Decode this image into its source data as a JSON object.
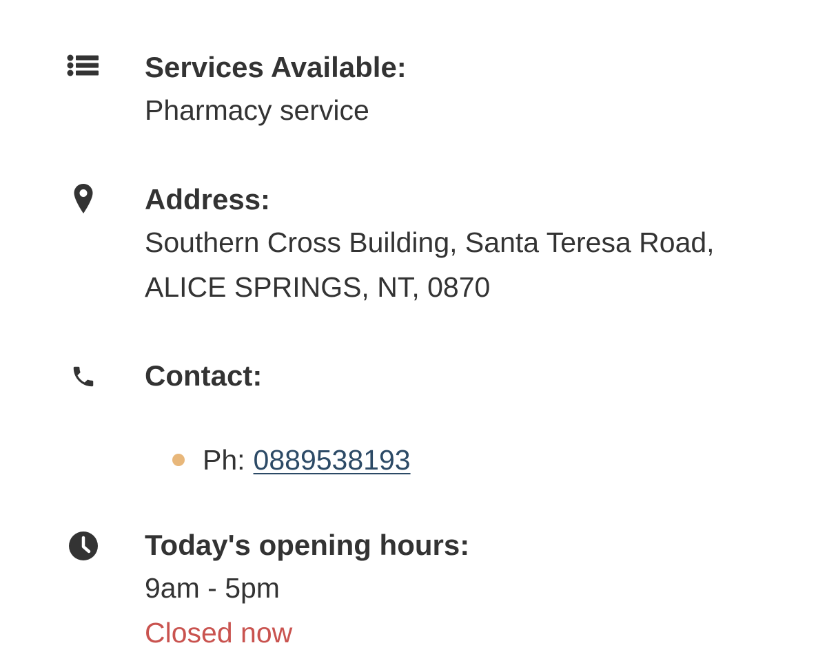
{
  "colors": {
    "text": "#333333",
    "link": "#2c4a66",
    "bullet": "#e8b77a",
    "closed_status": "#c9534f",
    "icon": "#333333"
  },
  "services": {
    "icon": "list-icon",
    "heading": "Services Available:",
    "value": "Pharmacy service"
  },
  "address": {
    "icon": "map-pin-icon",
    "heading": "Address:",
    "lines": [
      "Southern Cross Building, Santa Teresa Road,",
      "ALICE SPRINGS, NT, 0870"
    ]
  },
  "contact": {
    "icon": "phone-icon",
    "heading": "Contact:",
    "items": [
      {
        "label": "Ph:",
        "value": "0889538193"
      }
    ]
  },
  "hours": {
    "icon": "clock-icon",
    "heading": "Today's opening hours:",
    "value": "9am - 5pm",
    "status": "Closed now"
  }
}
